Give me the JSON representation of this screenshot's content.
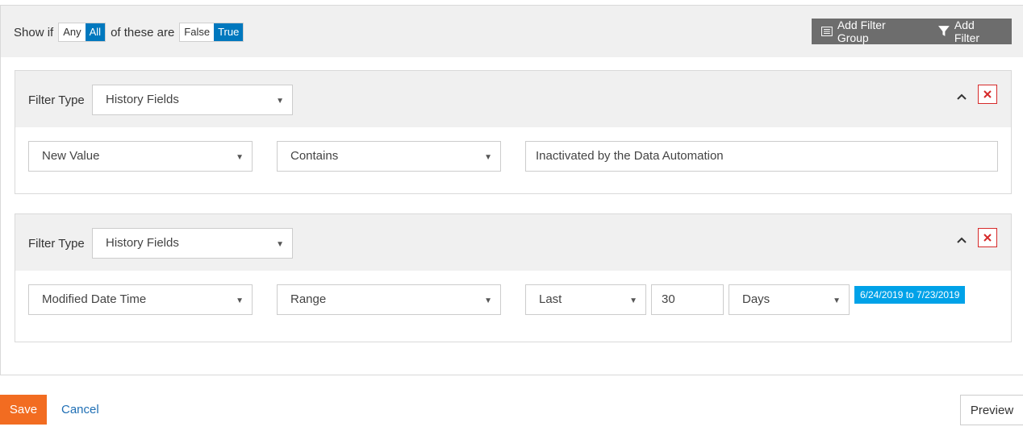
{
  "condition": {
    "show_if": "Show if",
    "any": "Any",
    "all": "All",
    "of_these_are": "of these are",
    "false": "False",
    "true": "True"
  },
  "actions": {
    "add_filter_group": "Add Filter Group",
    "add_filter": "Add Filter"
  },
  "filter_groups": [
    {
      "filter_type_label": "Filter Type",
      "filter_type": "History Fields",
      "field": "New Value",
      "operator": "Contains",
      "value": "Inactivated by the Data Automation"
    },
    {
      "filter_type_label": "Filter Type",
      "filter_type": "History Fields",
      "field": "Modified Date Time",
      "operator": "Range",
      "range_mode": "Last",
      "range_count": "30",
      "range_unit": "Days",
      "range_summary": "6/24/2019 to 7/23/2019"
    }
  ],
  "footer": {
    "save": "Save",
    "cancel": "Cancel",
    "preview": "Preview"
  },
  "colors": {
    "primary_blue": "#0078be",
    "save_orange": "#f26c21",
    "badge_blue": "#00a2e8",
    "remove_red": "#d62a2a"
  }
}
